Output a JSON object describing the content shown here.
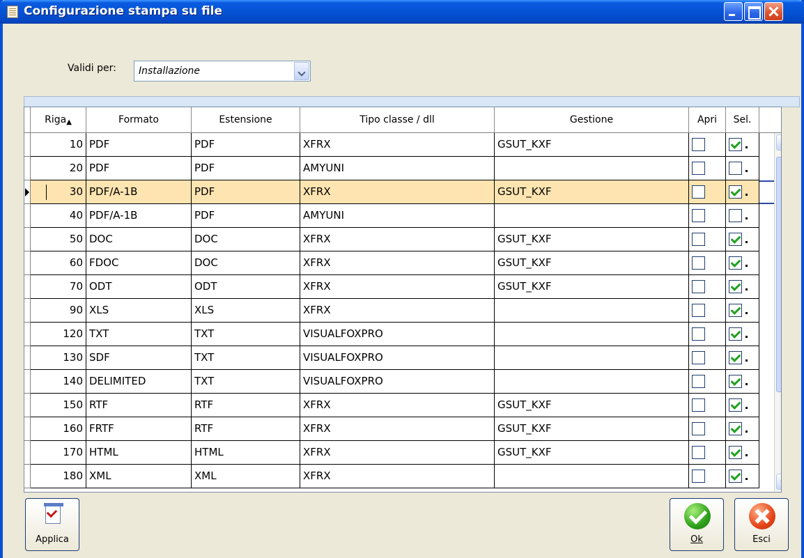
{
  "window": {
    "title": "Configurazione stampa su file",
    "title_icon": "document-icon",
    "controls": [
      "minimize",
      "maximize",
      "close"
    ]
  },
  "filter": {
    "label": "Validi per:",
    "value": "Installazione"
  },
  "grid": {
    "columns": {
      "riga": "Riga",
      "formato": "Formato",
      "estensione": "Estensione",
      "tipo": "Tipo classe / dll",
      "gestione": "Gestione",
      "apri": "Apri",
      "sel": "Sel."
    },
    "sort_indicator": "sort-ascending-icon",
    "selected_row": 2,
    "rows": [
      {
        "riga": "10",
        "formato": "PDF",
        "estensione": "PDF",
        "tipo": "XFRX",
        "gestione": "GSUT_KXF",
        "apri": false,
        "sel": true
      },
      {
        "riga": "20",
        "formato": "PDF",
        "estensione": "PDF",
        "tipo": "AMYUNI",
        "gestione": "",
        "apri": false,
        "sel": false
      },
      {
        "riga": "30",
        "formato": "PDF/A-1B",
        "estensione": "PDF",
        "tipo": "XFRX",
        "gestione": "GSUT_KXF",
        "apri": false,
        "sel": true
      },
      {
        "riga": "40",
        "formato": "PDF/A-1B",
        "estensione": "PDF",
        "tipo": "AMYUNI",
        "gestione": "",
        "apri": false,
        "sel": false
      },
      {
        "riga": "50",
        "formato": "DOC",
        "estensione": "DOC",
        "tipo": "XFRX",
        "gestione": "GSUT_KXF",
        "apri": false,
        "sel": true
      },
      {
        "riga": "60",
        "formato": "FDOC",
        "estensione": "DOC",
        "tipo": "XFRX",
        "gestione": "GSUT_KXF",
        "apri": false,
        "sel": true
      },
      {
        "riga": "70",
        "formato": "ODT",
        "estensione": "ODT",
        "tipo": "XFRX",
        "gestione": "GSUT_KXF",
        "apri": false,
        "sel": true
      },
      {
        "riga": "90",
        "formato": "XLS",
        "estensione": "XLS",
        "tipo": "XFRX",
        "gestione": "",
        "apri": false,
        "sel": true
      },
      {
        "riga": "120",
        "formato": "TXT",
        "estensione": "TXT",
        "tipo": "VISUALFOXPRO",
        "gestione": "",
        "apri": false,
        "sel": true
      },
      {
        "riga": "130",
        "formato": "SDF",
        "estensione": "TXT",
        "tipo": "VISUALFOXPRO",
        "gestione": "",
        "apri": false,
        "sel": true
      },
      {
        "riga": "140",
        "formato": "DELIMITED",
        "estensione": "TXT",
        "tipo": "VISUALFOXPRO",
        "gestione": "",
        "apri": false,
        "sel": true
      },
      {
        "riga": "150",
        "formato": "RTF",
        "estensione": "RTF",
        "tipo": "XFRX",
        "gestione": "GSUT_KXF",
        "apri": false,
        "sel": true
      },
      {
        "riga": "160",
        "formato": "FRTF",
        "estensione": "RTF",
        "tipo": "XFRX",
        "gestione": "GSUT_KXF",
        "apri": false,
        "sel": true
      },
      {
        "riga": "170",
        "formato": "HTML",
        "estensione": "HTML",
        "tipo": "XFRX",
        "gestione": "GSUT_KXF",
        "apri": false,
        "sel": true
      },
      {
        "riga": "180",
        "formato": "XML",
        "estensione": "XML",
        "tipo": "XFRX",
        "gestione": "",
        "apri": false,
        "sel": true
      }
    ]
  },
  "buttons": {
    "applica": "Applica",
    "ok": "Ok",
    "esci": "Esci"
  },
  "colors": {
    "title_bar": "#0553d5",
    "selected_row": "#fde4b0",
    "checkmark": "#21a121"
  }
}
